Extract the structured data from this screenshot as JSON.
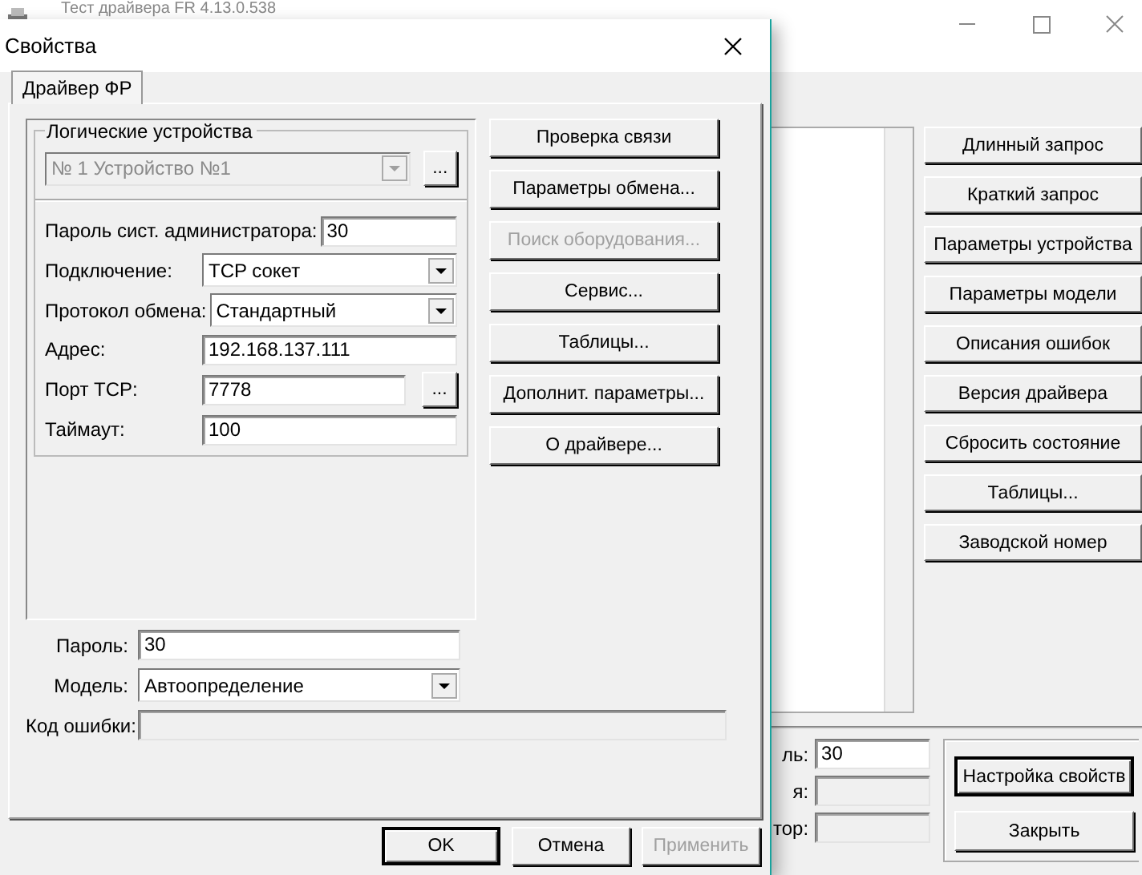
{
  "background_window": {
    "title": "Тест драйвера FR 4.13.0.538",
    "buttons": [
      {
        "label": "Длинный запрос"
      },
      {
        "label": "Краткий запрос"
      },
      {
        "label": "Параметры устройства"
      },
      {
        "label": "Параметры модели"
      },
      {
        "label": "Описания ошибок"
      },
      {
        "label": "Версия драйвера"
      },
      {
        "label": "Сбросить состояние"
      },
      {
        "label": "Таблицы..."
      },
      {
        "label": "Заводской номер"
      }
    ],
    "fields": [
      {
        "label": "ль:",
        "value": "30",
        "disabled": false
      },
      {
        "label": "я:",
        "disabled": true
      },
      {
        "label": "тор:",
        "disabled": true
      }
    ],
    "bottom_buttons": [
      {
        "label": "Настройка свойств",
        "selected": true
      },
      {
        "label": "Закрыть",
        "selected": false
      }
    ]
  },
  "dialog": {
    "title": "Свойства",
    "tabs": [
      {
        "label": "Драйвер ФР",
        "selected": true
      }
    ],
    "group_label": "Логические устройства",
    "device": {
      "value": "№ 1 Устройство №1",
      "disabled": true,
      "browse": "..."
    },
    "fields": [
      {
        "kind": "text",
        "label": "Пароль сист. администратора:",
        "value": "30"
      },
      {
        "kind": "select",
        "label": "Подключение:",
        "value": "TCP сокет"
      },
      {
        "kind": "select",
        "label": "Протокол обмена:",
        "value": "Стандартный"
      },
      {
        "kind": "text",
        "label": "Адрес:",
        "value": "192.168.137.111"
      },
      {
        "kind": "browse",
        "label": "Порт TCP:",
        "value": "7778",
        "browse": "..."
      },
      {
        "kind": "text",
        "label": "Таймаут:",
        "value": "100"
      }
    ],
    "side_buttons": [
      {
        "label": "Проверка связи",
        "disabled": false
      },
      {
        "label": "Параметры обмена...",
        "disabled": false
      },
      {
        "label": "Поиск оборудования...",
        "disabled": true
      },
      {
        "label": "Сервис...",
        "disabled": false
      },
      {
        "label": "Таблицы...",
        "disabled": false
      },
      {
        "label": "Дополнит. параметры...",
        "disabled": false
      },
      {
        "label": "О драйвере...",
        "disabled": false
      }
    ],
    "lower_fields": [
      {
        "kind": "text",
        "label": "Пароль:",
        "value": "30",
        "disabled": false
      },
      {
        "kind": "select",
        "label": "Модель:",
        "value": "Автоопределение",
        "disabled": false
      },
      {
        "kind": "wide",
        "label": "Код ошибки:",
        "disabled": true
      }
    ],
    "footer_buttons": [
      {
        "label": "OK",
        "disabled": false,
        "selected": true
      },
      {
        "label": "Отмена",
        "disabled": false,
        "selected": false
      },
      {
        "label": "Применить",
        "disabled": true,
        "selected": false
      }
    ]
  }
}
